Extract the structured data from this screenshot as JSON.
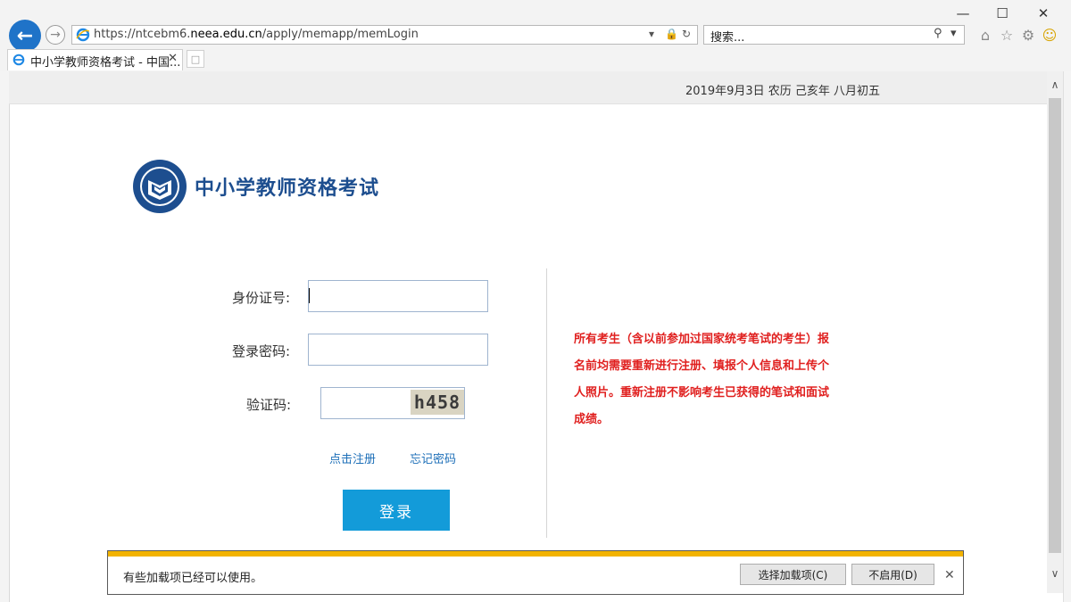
{
  "browser": {
    "url_prefix": "https://ntcebm6.",
    "url_domain": "neea.edu.cn",
    "url_path": "/apply/memapp/memLogin",
    "search_placeholder": "搜索...",
    "tab_title": "中小学教师资格考试 - 中国...",
    "window_controls": [
      "minimize-icon",
      "maximize-icon",
      "close-icon"
    ],
    "toolbar_icons": [
      "home-icon",
      "favorites-star-icon",
      "settings-gear-icon",
      "smiley-feedback-icon"
    ]
  },
  "page": {
    "date_line": "2019年9月3日  农历 己亥年 八月初五",
    "brand_title": "中小学教师资格考试",
    "form": {
      "id_label": "身份证号:",
      "password_label": "登录密码:",
      "captcha_label": "验证码:",
      "id_value": "",
      "password_value": "",
      "captcha_value": "",
      "captcha_image_text": "h458",
      "register_link": "点击注册",
      "forgot_link": "忘记密码",
      "login_button": "登录"
    },
    "notice": "所有考生（含以前参加过国家统考笔试的考生）报名前均需要重新进行注册、填报个人信息和上传个人照片。重新注册不影响考生已获得的笔试和面试成绩。"
  },
  "notification": {
    "message": "有些加载项已经可以使用。",
    "choose_button": "选择加载项(C)",
    "disable_button": "不启用(D)"
  },
  "colors": {
    "brand_blue": "#1d4e8f",
    "login_button": "#139bd9",
    "notice_red": "#e0201f",
    "link_blue": "#1d6fb8",
    "notify_band": "#f2b300"
  }
}
